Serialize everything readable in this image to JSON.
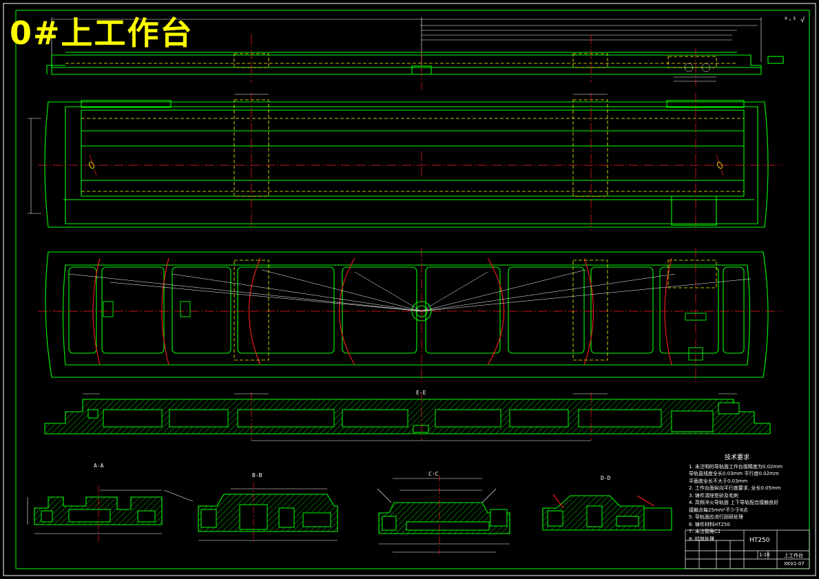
{
  "drawing_title": "0#上工作台",
  "roughness_mark": "⁶·³ √",
  "colors": {
    "background": "#000000",
    "outline": "#00ff00",
    "centerline": "#ff2020",
    "hidden": "#ffff00",
    "dimension": "#ffffff",
    "hatch": "#00ff00",
    "title_text": "#ffff00"
  },
  "section_labels": {
    "e_e": "E-E",
    "a_a": "A-A",
    "b_b": "B-B",
    "c_c": "C-C",
    "d_d": "D-D"
  },
  "technical_requirements": {
    "title": "技术要求",
    "items": [
      "1. 未注明的导轨面工作台面精度为0.02mm",
      "   导轨直线度全长0.03mm 平行度0.02mm",
      "   平面度全长不大于0.03mm",
      "2. 工作台面纵向平行度要求, 全长0.05mm",
      "3. 铸件清除型砂及毛刺",
      "4. 高频淬火导轨面 上下导轨配合接触良好",
      "   接触点每25mm²不少于8点",
      "5. 导轨面应进行刮研处理",
      "6. 铸件材料HT250",
      "7. 未注倒角C1",
      "8. 时效处理"
    ]
  },
  "title_block": {
    "material": "HT250",
    "drawing_name": "上工作台",
    "drawing_no": "XK01-07",
    "scale": "1:10"
  }
}
